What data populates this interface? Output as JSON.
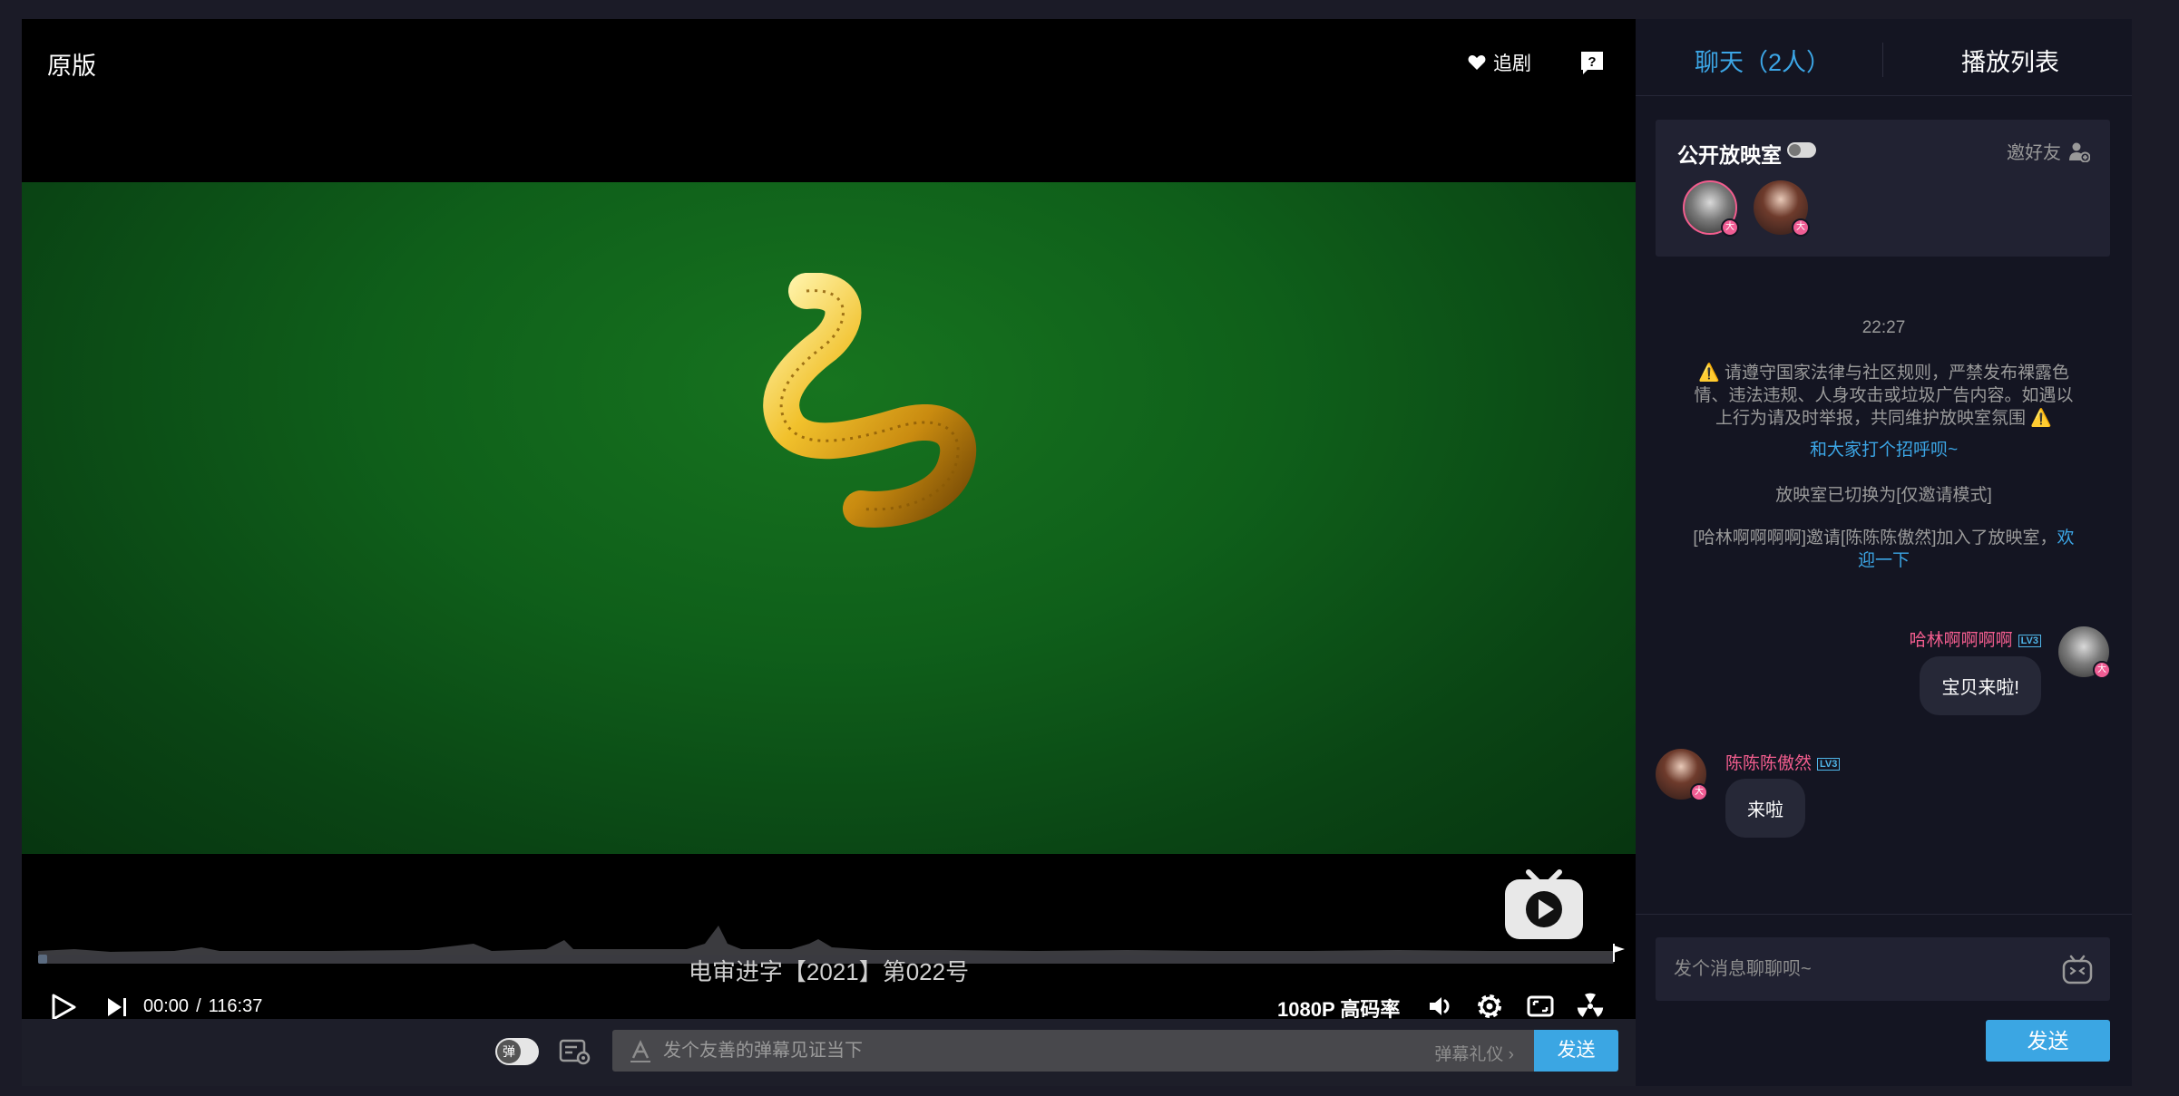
{
  "player": {
    "version_label": "原版",
    "follow_label": "追剧",
    "subtitle": "电审进字【2021】第022号",
    "current_time": "00:00",
    "separator": "/",
    "total_time": "116:37",
    "progress": 0.006,
    "quality": "1080P 高码率"
  },
  "danmaku": {
    "toggle_label": "弹",
    "placeholder": "发个友善的弹幕见证当下",
    "etiquette_label": "弹幕礼仪 ›",
    "send_label": "发送"
  },
  "side_panel": {
    "tab_chat": "聊天（2人）",
    "tab_playlist": "播放列表",
    "room": {
      "title": "公开放映室",
      "invite_label": "邀好友",
      "badge": "大"
    },
    "chat": {
      "time": "22:27",
      "notice": "⚠️ 请遵守国家法律与社区规则，严禁发布裸露色情、违法违规、人身攻击或垃圾广告内容。如遇以上行为请及时举报，共同维护放映室氛围 ⚠️",
      "greet": "和大家打个招呼呗~",
      "mode_notice": "放映室已切换为[仅邀请模式]",
      "invite_notice_prefix": "[哈林啊啊啊啊]邀请[陈陈陈傲然]加入了放映室，",
      "invite_notice_welcome": "欢迎一下",
      "messages": [
        {
          "name": "哈林啊啊啊啊",
          "level": "LV3",
          "text": "宝贝来啦!"
        },
        {
          "name": "陈陈陈傲然",
          "level": "LV3",
          "text": "来啦"
        }
      ],
      "input_placeholder": "发个消息聊聊呗~",
      "send_label": "发送"
    }
  },
  "colors": {
    "accent": "#3ba6e3",
    "username": "#f25d8e",
    "panel_bg": "#141522",
    "card_bg": "#212232"
  }
}
